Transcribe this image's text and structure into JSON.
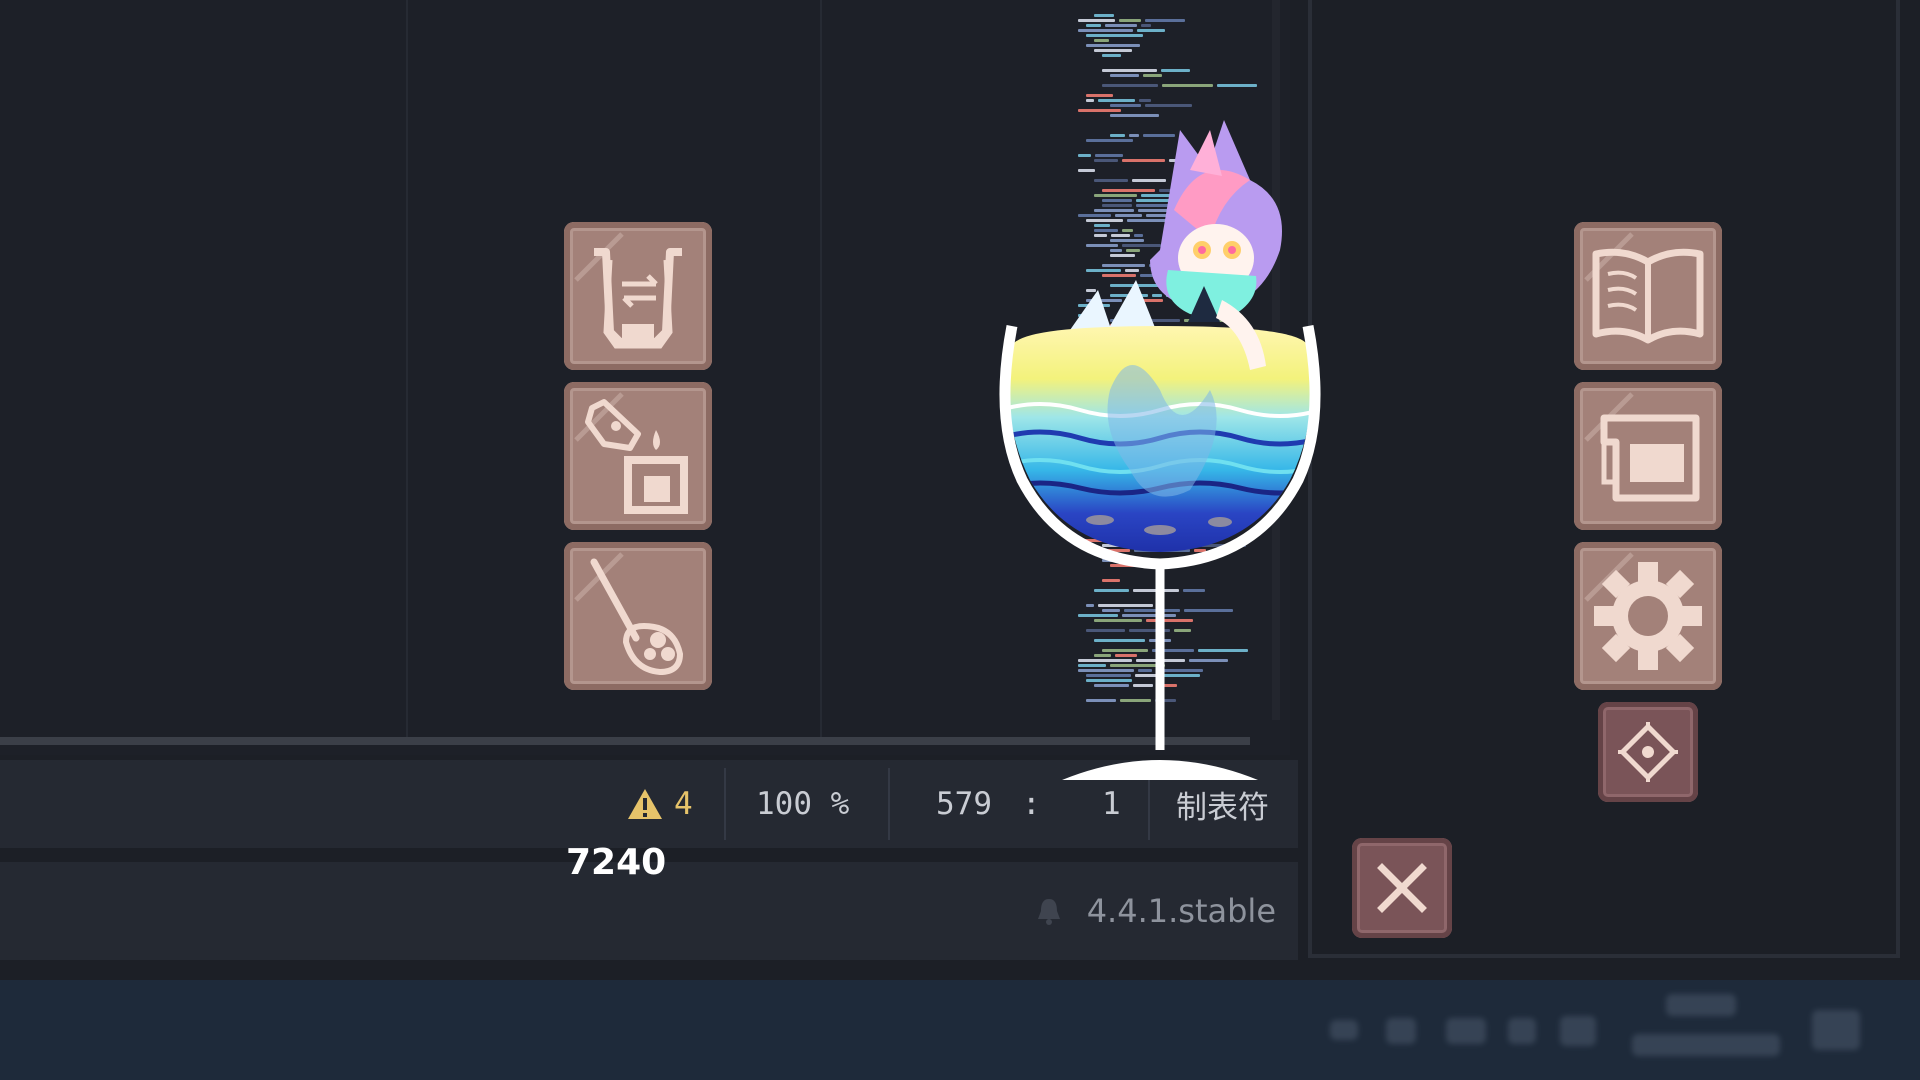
{
  "statusbar": {
    "warnings": "4",
    "zoom": "100 %",
    "line": "579",
    "separator": ":",
    "column": "1",
    "indent_mode": "制表符"
  },
  "bottom": {
    "version": "4.4.1.stable"
  },
  "game": {
    "score": "7240",
    "left_tools": [
      {
        "name": "swap-cup-icon"
      },
      {
        "name": "pour-bottle-icon"
      },
      {
        "name": "spoon-icon"
      }
    ],
    "right_tools": [
      {
        "name": "book-icon"
      },
      {
        "name": "window-icon"
      },
      {
        "name": "gear-icon"
      }
    ],
    "small_tools": [
      {
        "name": "move-target-icon"
      },
      {
        "name": "close-icon"
      }
    ]
  },
  "colors": {
    "button_bg": "#a38179",
    "button_line": "#f0d9cf",
    "small_button_bg": "#7a5458",
    "warning": "#e6c36a",
    "editor_bg": "#1d2028",
    "taskbar": "#1e2a3a"
  }
}
